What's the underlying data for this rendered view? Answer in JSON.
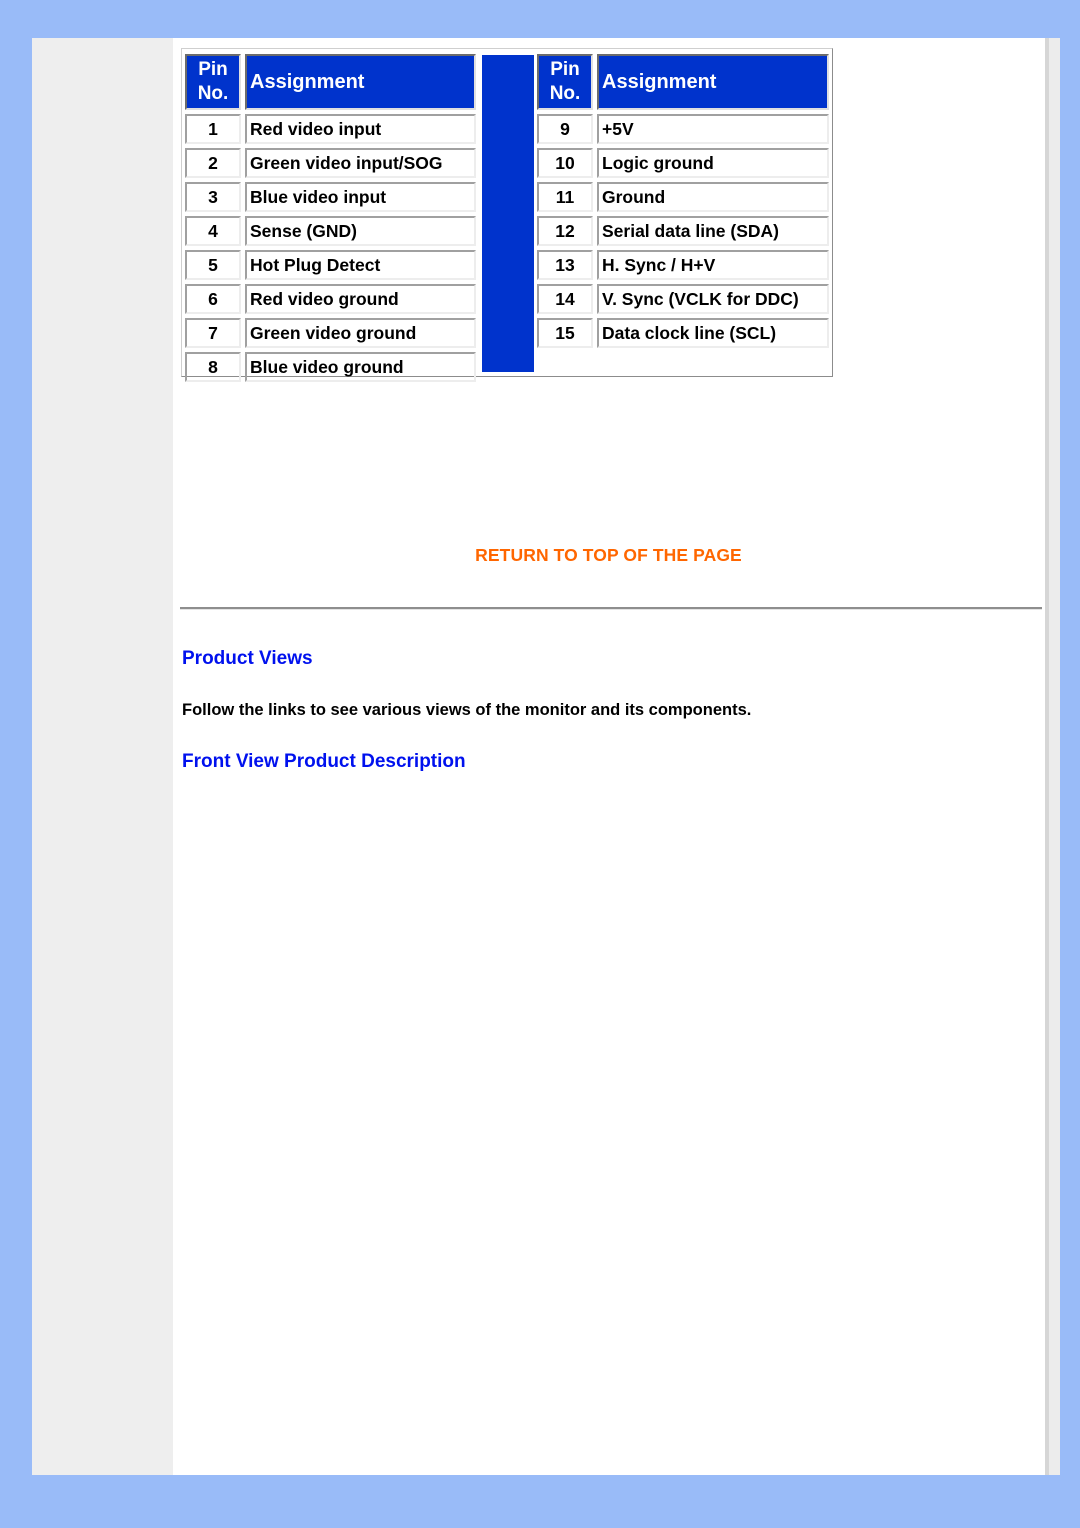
{
  "colors": {
    "background": "#99bbf8",
    "header_fill": "#0033cc",
    "link_orange": "#ff6600",
    "link_blue": "#0011ee"
  },
  "pin_table": {
    "header": {
      "pin_line1": "Pin",
      "pin_line2": "No.",
      "assignment": "Assignment"
    },
    "left_rows": [
      {
        "pin": "1",
        "assignment": "Red video input"
      },
      {
        "pin": "2",
        "assignment": "Green video input/SOG"
      },
      {
        "pin": "3",
        "assignment": "Blue video input"
      },
      {
        "pin": "4",
        "assignment": "Sense (GND)"
      },
      {
        "pin": "5",
        "assignment": "Hot Plug Detect"
      },
      {
        "pin": "6",
        "assignment": "Red video ground"
      },
      {
        "pin": "7",
        "assignment": "Green video ground"
      },
      {
        "pin": "8",
        "assignment": "Blue video ground"
      }
    ],
    "right_rows": [
      {
        "pin": "9",
        "assignment": "+5V"
      },
      {
        "pin": "10",
        "assignment": "Logic ground"
      },
      {
        "pin": "11",
        "assignment": "Ground"
      },
      {
        "pin": "12",
        "assignment": "Serial data line (SDA)"
      },
      {
        "pin": "13",
        "assignment": "H. Sync / H+V"
      },
      {
        "pin": "14",
        "assignment": "V. Sync (VCLK for DDC)"
      },
      {
        "pin": "15",
        "assignment": "Data clock line (SCL)"
      }
    ]
  },
  "return_link": "RETURN TO TOP OF THE PAGE",
  "product_views": {
    "title": "Product Views",
    "description": "Follow the links to see various views of the monitor and its components.",
    "links": [
      "Front View Product Description"
    ]
  }
}
